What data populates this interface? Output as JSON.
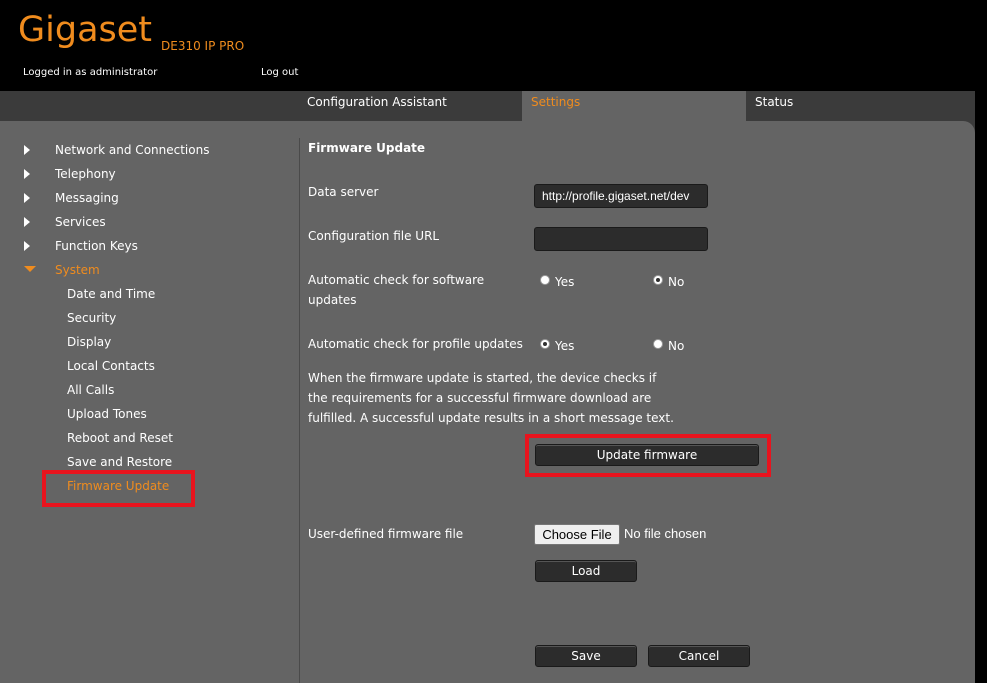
{
  "header": {
    "logo_text": "Gigaset",
    "model": "DE310 IP PRO",
    "logged_in_text": "Logged in as administrator",
    "logout_label": "Log out"
  },
  "tabs": [
    {
      "label": "Configuration Assistant",
      "active": false
    },
    {
      "label": "Settings",
      "active": true
    },
    {
      "label": "Status",
      "active": false
    }
  ],
  "sidebar": {
    "sections": [
      {
        "label": "Network and Connections",
        "expanded": false
      },
      {
        "label": "Telephony",
        "expanded": false
      },
      {
        "label": "Messaging",
        "expanded": false
      },
      {
        "label": "Services",
        "expanded": false
      },
      {
        "label": "Function Keys",
        "expanded": false
      },
      {
        "label": "System",
        "expanded": true
      }
    ],
    "system_items": [
      {
        "label": "Date and Time"
      },
      {
        "label": "Security"
      },
      {
        "label": "Display"
      },
      {
        "label": "Local Contacts"
      },
      {
        "label": "All Calls"
      },
      {
        "label": "Upload Tones"
      },
      {
        "label": "Reboot and Reset"
      },
      {
        "label": "Save and Restore"
      },
      {
        "label": "Firmware Update",
        "active": true
      }
    ]
  },
  "content": {
    "title": "Firmware Update",
    "data_server": {
      "label": "Data server",
      "value": "http://profile.gigaset.net/dev"
    },
    "config_file_url": {
      "label": "Configuration file URL",
      "value": ""
    },
    "auto_sw_check": {
      "label_line1": "Automatic check for software",
      "label_line2": "updates",
      "options": [
        "Yes",
        "No"
      ],
      "selected": "No"
    },
    "auto_profile_check": {
      "label": "Automatic check for profile updates",
      "options": [
        "Yes",
        "No"
      ],
      "selected": "Yes"
    },
    "info_text": "When the firmware update is started, the device checks if the requirements for a successful firmware download are fulfilled. A successful update results in a short message text.",
    "update_button_label": "Update firmware",
    "user_file": {
      "label": "User-defined firmware file",
      "choose_label": "Choose File",
      "status": "No file chosen",
      "load_label": "Load"
    },
    "save_label": "Save",
    "cancel_label": "Cancel"
  },
  "colors": {
    "accent": "#f08c1e",
    "highlight": "#e8141e",
    "panel": "#646464",
    "tabbar": "#3b3b3b"
  }
}
